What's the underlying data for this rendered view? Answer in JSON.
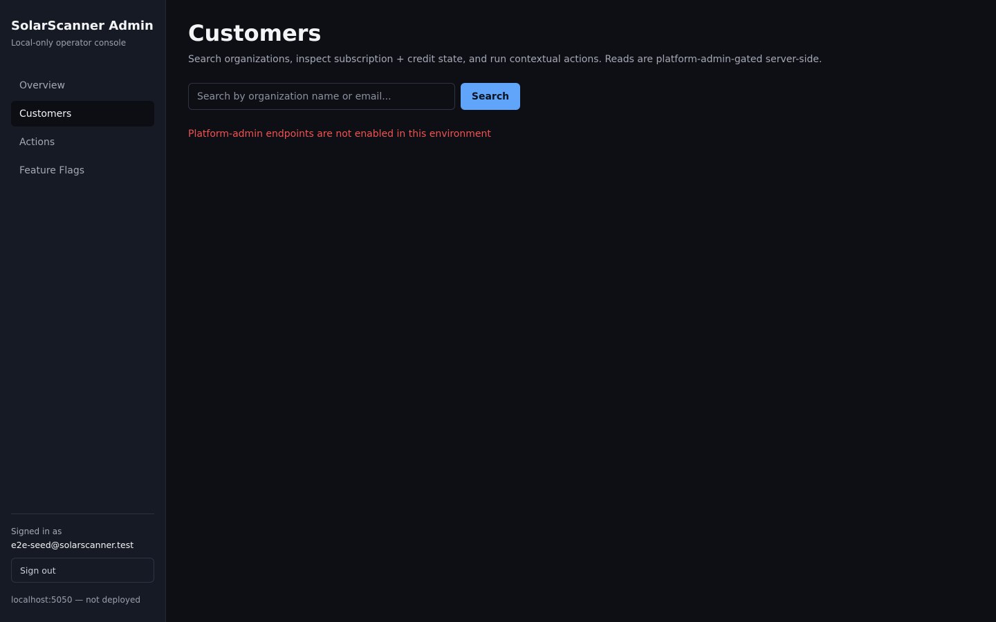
{
  "sidebar": {
    "title": "SolarScanner Admin",
    "subtitle": "Local-only operator console",
    "items": [
      {
        "label": "Overview",
        "active": false
      },
      {
        "label": "Customers",
        "active": true
      },
      {
        "label": "Actions",
        "active": false
      },
      {
        "label": "Feature Flags",
        "active": false
      }
    ],
    "footer": {
      "signed_in_label": "Signed in as",
      "email": "e2e-seed@solarscanner.test",
      "signout_label": "Sign out",
      "env_note": "localhost:5050 — not deployed"
    }
  },
  "main": {
    "title": "Customers",
    "description": "Search organizations, inspect subscription + credit state, and run contextual actions. Reads are platform-admin-gated server-side.",
    "search": {
      "placeholder": "Search by organization name or email...",
      "value": "",
      "button_label": "Search"
    },
    "error": "Platform-admin endpoints are not enabled in this environment"
  },
  "colors": {
    "accent": "#60a5fa",
    "error": "#f05252",
    "background": "#0d0f14",
    "sidebar": "#161a24"
  }
}
